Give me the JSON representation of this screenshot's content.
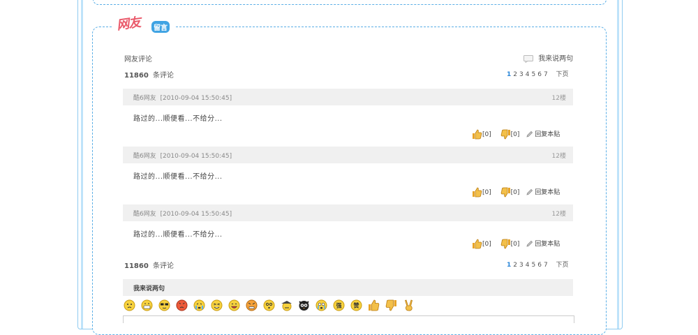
{
  "logo": {
    "big": "网友",
    "small": "留言"
  },
  "header": {
    "section_label": "网友评论",
    "post_link": "我来说两句",
    "count": "11860",
    "count_suffix": "条评论"
  },
  "pager": {
    "pages": [
      "1",
      "2",
      "3",
      "4",
      "5",
      "6",
      "7"
    ],
    "current": "1",
    "next": "下页"
  },
  "comments": [
    {
      "author": "酷6网友",
      "time": "[2010-09-04 15:50:45]",
      "floor": "12楼",
      "text": "路过的...顺便看...不给分...",
      "up": "[0]",
      "down": "[0]",
      "reply": "回复本贴"
    },
    {
      "author": "酷6网友",
      "time": "[2010-09-04 15:50:45]",
      "floor": "12楼",
      "text": "路过的...顺便看...不给分...",
      "up": "[0]",
      "down": "[0]",
      "reply": "回复本贴"
    },
    {
      "author": "酷6网友",
      "time": "[2010-09-04 15:50:45]",
      "floor": "12楼",
      "text": "路过的...顺便看...不给分...",
      "up": "[0]",
      "down": "[0]",
      "reply": "回复本贴"
    }
  ],
  "footer": {
    "count": "11860",
    "count_suffix": "条评论"
  },
  "form": {
    "title": "我来说两句"
  },
  "emoticons": [
    "thinking-face",
    "grin-face",
    "cool-sunglasses-face",
    "angry-red-face",
    "crying-face",
    "squint-laugh-face",
    "laughing-face",
    "mad-face",
    "dizzy-face",
    "hat-man-face",
    "owl-face",
    "shocked-crying-face",
    "strong-badge",
    "zan-badge",
    "thumbs-up",
    "thumbs-down",
    "victory-hand"
  ],
  "colors": {
    "accent": "#2a86d8",
    "border": "#5aaee6",
    "bar": "#f0f0f0",
    "thumb": "#e8a428"
  }
}
